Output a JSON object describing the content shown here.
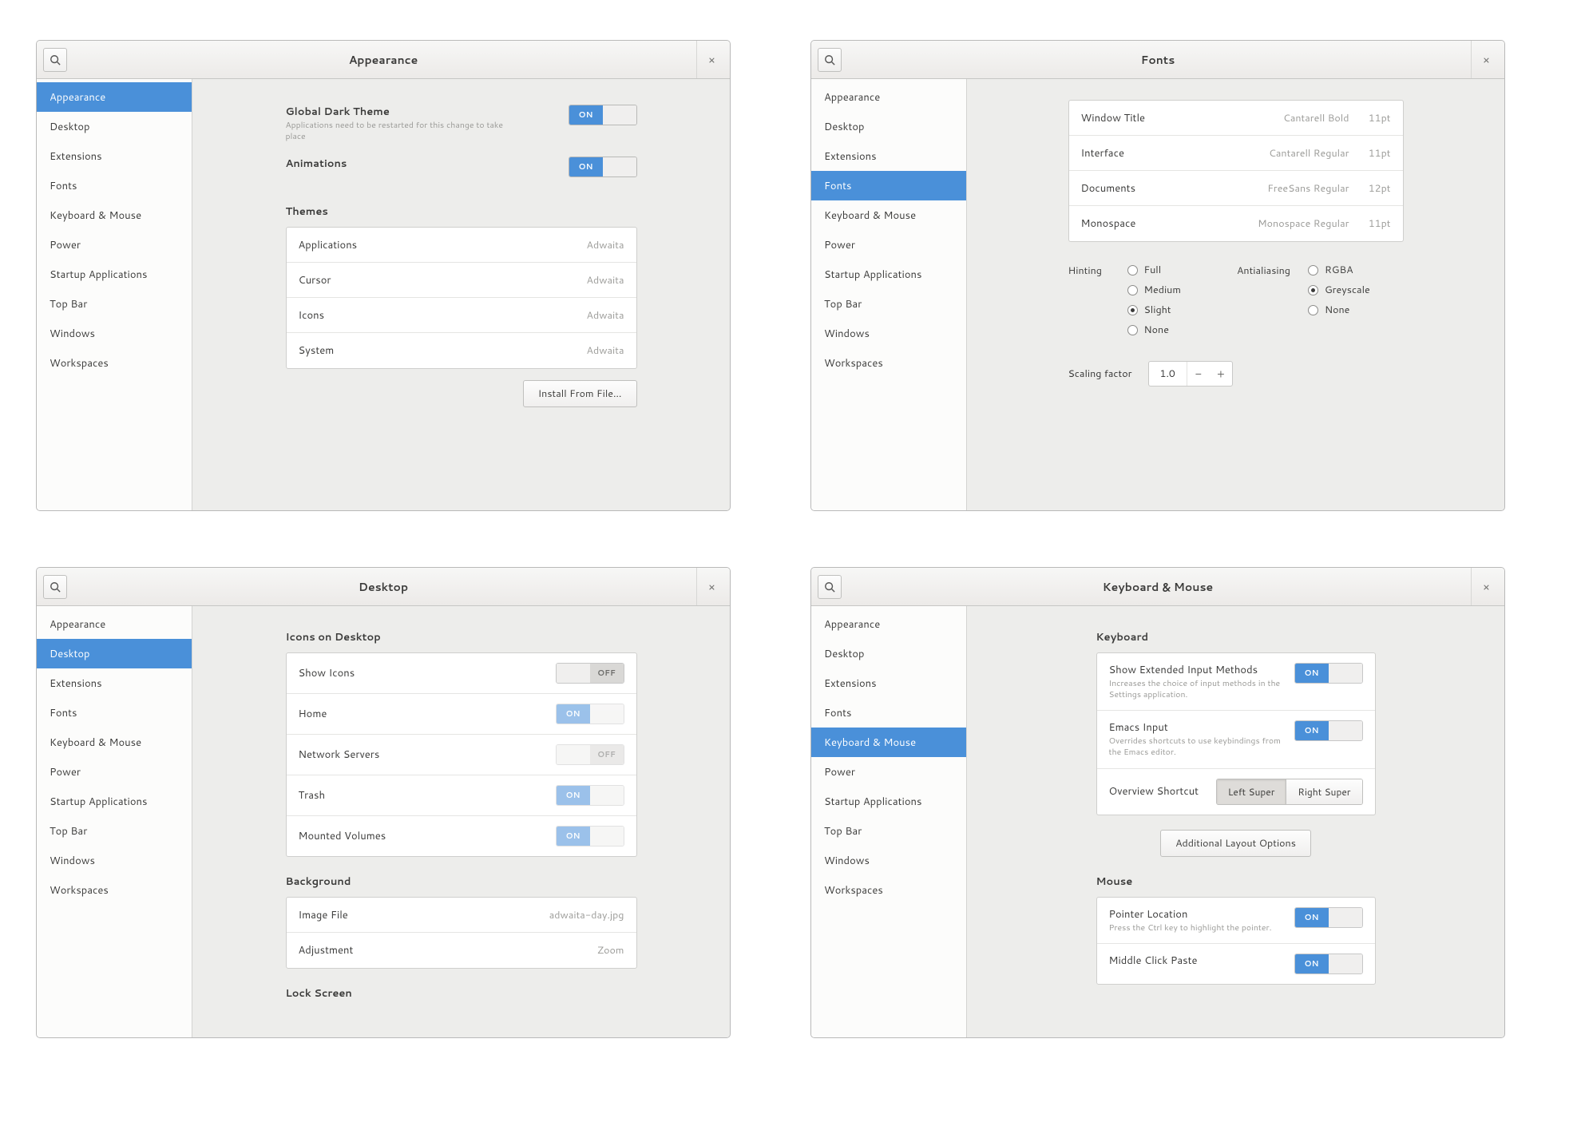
{
  "sidebar_items": [
    "Appearance",
    "Desktop",
    "Extensions",
    "Fonts",
    "Keyboard & Mouse",
    "Power",
    "Startup Applications",
    "Top Bar",
    "Windows",
    "Workspaces"
  ],
  "toggle": {
    "on": "ON",
    "off": "OFF"
  },
  "panels": {
    "appearance": {
      "title": "Appearance",
      "dark": {
        "label": "Global Dark Theme",
        "sub": "Applications need to be restarted for this change to take place"
      },
      "anim": {
        "label": "Animations"
      },
      "section_themes": "Themes",
      "themes": [
        {
          "label": "Applications",
          "value": "Adwaita"
        },
        {
          "label": "Cursor",
          "value": "Adwaita"
        },
        {
          "label": "Icons",
          "value": "Adwaita"
        },
        {
          "label": "System",
          "value": "Adwaita"
        }
      ],
      "install": "Install From File…"
    },
    "fonts": {
      "title": "Fonts",
      "rows": [
        {
          "label": "Window Title",
          "font": "Cantarell Bold",
          "size": "11pt"
        },
        {
          "label": "Interface",
          "font": "Cantarell Regular",
          "size": "11pt"
        },
        {
          "label": "Documents",
          "font": "FreeSans Regular",
          "size": "12pt"
        },
        {
          "label": "Monospace",
          "font": "Monospace Regular",
          "size": "11pt"
        }
      ],
      "hinting_label": "Hinting",
      "hinting": [
        "Full",
        "Medium",
        "Slight",
        "None"
      ],
      "hinting_selected": "Slight",
      "aa_label": "Antialiasing",
      "aa": [
        "RGBA",
        "Greyscale",
        "None"
      ],
      "aa_selected": "Greyscale",
      "scaling_label": "Scaling factor",
      "scaling_value": "1.0"
    },
    "desktop": {
      "title": "Desktop",
      "section_icons": "Icons on Desktop",
      "toggles": [
        {
          "label": "Show Icons",
          "state": "off",
          "disabled": false
        },
        {
          "label": "Home",
          "state": "on",
          "disabled": true
        },
        {
          "label": "Network Servers",
          "state": "off",
          "disabled": true
        },
        {
          "label": "Trash",
          "state": "on",
          "disabled": true
        },
        {
          "label": "Mounted Volumes",
          "state": "on",
          "disabled": true
        }
      ],
      "section_bg": "Background",
      "bg_rows": [
        {
          "label": "Image File",
          "value": "adwaita-day.jpg"
        },
        {
          "label": "Adjustment",
          "value": "Zoom"
        }
      ],
      "section_lock": "Lock Screen"
    },
    "km": {
      "title": "Keyboard & Mouse",
      "section_kbd": "Keyboard",
      "kbd_rows": [
        {
          "label": "Show Extended Input Methods",
          "sub": "Increases the choice of input methods in the Settings application."
        },
        {
          "label": "Emacs Input",
          "sub": "Overrides shortcuts to use keybindings from the Emacs editor."
        }
      ],
      "overview_label": "Overview Shortcut",
      "overview_options": [
        "Left Super",
        "Right Super"
      ],
      "overview_selected": "Left Super",
      "additional": "Additional Layout Options",
      "section_mouse": "Mouse",
      "mouse_rows": [
        {
          "label": "Pointer Location",
          "sub": "Press the Ctrl key to highlight the pointer."
        },
        {
          "label": "Middle Click Paste",
          "sub": ""
        }
      ]
    }
  }
}
